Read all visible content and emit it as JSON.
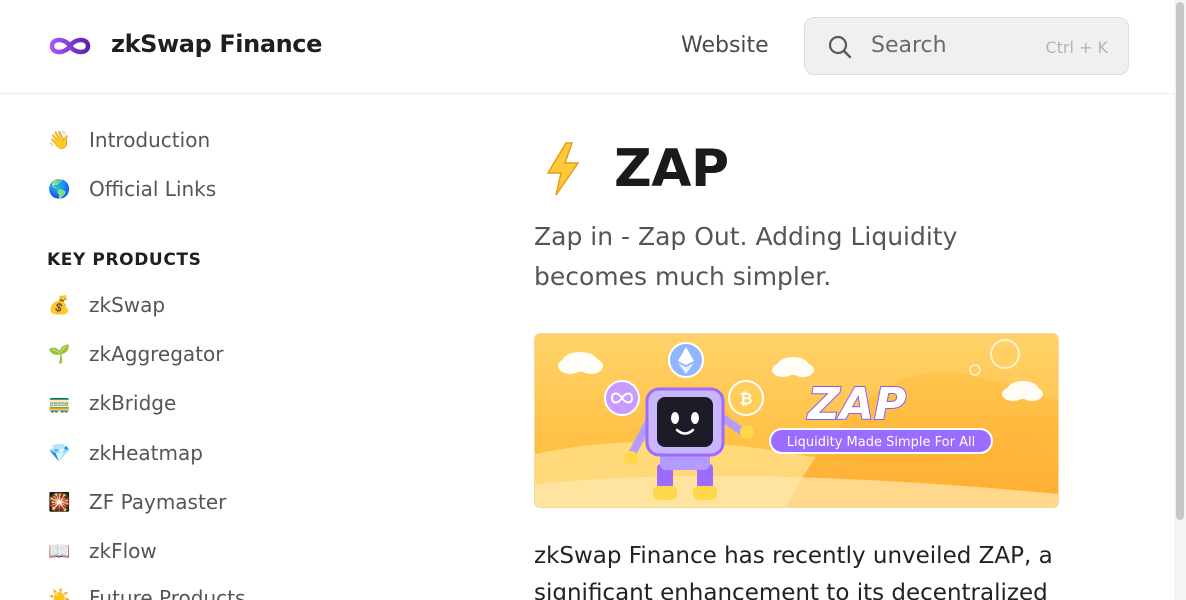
{
  "header": {
    "brand": "zkSwap Finance",
    "logo_icon": "infinity-logo-icon",
    "nav_link": "Website",
    "search_placeholder": "Search",
    "search_shortcut": "Ctrl + K"
  },
  "sidebar": {
    "top_items": [
      {
        "label": "Introduction",
        "icon": "👋"
      },
      {
        "label": "Official Links",
        "icon": "🌎"
      }
    ],
    "section_heading": "KEY PRODUCTS",
    "product_items": [
      {
        "label": "zkSwap",
        "icon": "💰"
      },
      {
        "label": "zkAggregator",
        "icon": "🌱"
      },
      {
        "label": "zkBridge",
        "icon": "🚃"
      },
      {
        "label": "zkHeatmap",
        "icon": "💎"
      },
      {
        "label": "ZF Paymaster",
        "icon": "🎇"
      },
      {
        "label": "zkFlow",
        "icon": "📖"
      },
      {
        "label": "Future Products",
        "icon": "☀️"
      }
    ]
  },
  "main": {
    "title_icon": "⚡",
    "title": "ZAP",
    "subtitle": "Zap in - Zap Out. Adding Liquidity becomes much simpler.",
    "banner": {
      "title": "ZAP",
      "tagline": "Liquidity Made Simple For All"
    },
    "body": "zkSwap Finance has recently unveiled ZAP, a significant enhancement to its decentralized"
  },
  "colors": {
    "brand_purple": "#7b3fe4",
    "banner_orange": "#ffb938",
    "banner_purple": "#9b6cff"
  }
}
